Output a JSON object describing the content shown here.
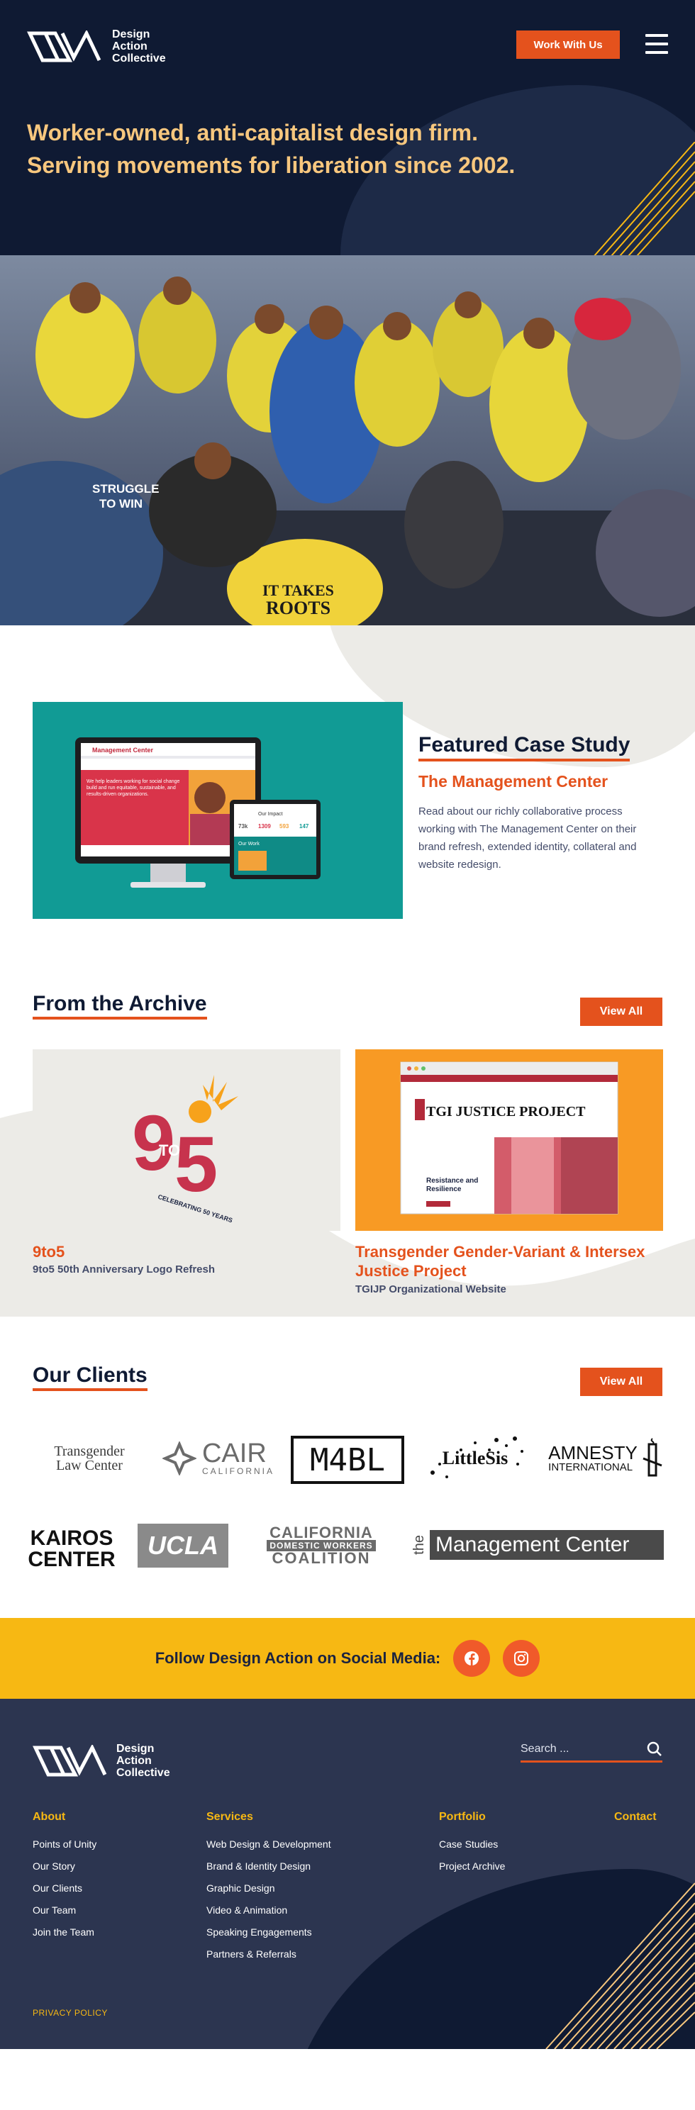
{
  "header": {
    "logo_text_1": "Design",
    "logo_text_2": "Action",
    "logo_text_3": "Collective",
    "cta_label": "Work With Us",
    "tagline": "Worker-owned, anti-capitalist design firm. Serving movements for liberation since 2002."
  },
  "hero_photo": {
    "sign_1": "STRUGGLE",
    "sign_2": "TO WIN",
    "sign_3": "IT TAKES",
    "sign_4": "ROOTS"
  },
  "featured": {
    "title": "Featured Case Study",
    "client": "The Management Center",
    "description": "Read about our richly collaborative process working with The Management Center on their brand refresh, extended identity, collateral and website redesign.",
    "mock_brand": "Management Center",
    "mock_hero": "We help leaders working for social change build and run equitable, sustainable, and results-driven organizations.",
    "mock_impact": "Our Impact",
    "mock_stats": [
      "73k",
      "1309",
      "593",
      "147"
    ],
    "mock_work": "Our Work"
  },
  "archive": {
    "title": "From the Archive",
    "view_all": "View All",
    "cards": [
      {
        "title": "9to5",
        "subtitle": "9to5 50th Anniversary Logo Refresh",
        "logo_to": "TO",
        "logo_ring": "CELEBRATING 50 YEARS"
      },
      {
        "title": "Transgender Gender-Variant & Intersex Justice Project",
        "subtitle": "TGIJP Organizational Website",
        "mock_heading": "TGI JUSTICE PROJECT",
        "mock_text": "Resistance and Resilience"
      }
    ]
  },
  "clients": {
    "title": "Our Clients",
    "view_all": "View All",
    "logos": [
      "Transgender Law Center",
      "CAIR CALIFORNIA",
      "M4BL",
      "LittleSis",
      "AMNESTY INTERNATIONAL",
      "KAIROS CENTER",
      "UCLA",
      "CALIFORNIA DOMESTIC WORKERS COALITION",
      "the Management Center"
    ],
    "logo_parts": {
      "tlc_1": "Transgender",
      "tlc_2": "Law Center",
      "cair_1": "CAIR",
      "cair_2": "CALIFORNIA",
      "amnesty_1": "AMNESTY",
      "amnesty_2": "INTERNATIONAL",
      "kairos_1": "KAIROS",
      "kairos_2": "CENTER",
      "cdwc_1": "CALIFORNIA",
      "cdwc_2": "DOMESTIC WORKERS",
      "cdwc_3": "COALITION",
      "tmc_the": "the",
      "tmc_name": "Management Center"
    }
  },
  "social": {
    "label": "Follow Design Action on Social Media:",
    "links": [
      "facebook",
      "instagram"
    ]
  },
  "footer": {
    "search_placeholder": "Search ...",
    "columns": [
      {
        "heading": "About",
        "items": [
          "Points of Unity",
          "Our Story",
          "Our Clients",
          "Our Team",
          "Join the Team"
        ]
      },
      {
        "heading": "Services",
        "items": [
          "Web Design & Development",
          "Brand & Identity Design",
          "Graphic Design",
          "Video & Animation",
          "Speaking Engagements",
          "Partners & Referrals"
        ]
      },
      {
        "heading": "Portfolio",
        "items": [
          "Case Studies",
          "Project Archive"
        ]
      },
      {
        "heading": "Contact",
        "items": []
      }
    ],
    "privacy": "PRIVACY POLICY"
  },
  "colors": {
    "navy": "#0f1a33",
    "orange": "#e4521d",
    "gold": "#f7b813",
    "peach": "#f7c77e",
    "teal": "#119b95"
  }
}
